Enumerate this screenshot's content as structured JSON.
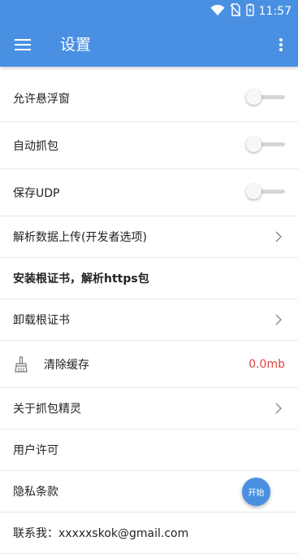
{
  "status": {
    "time": "11:57"
  },
  "appbar": {
    "title": "设置"
  },
  "settings": {
    "float_window": "允许悬浮窗",
    "auto_capture": "自动抓包",
    "save_udp": "保存UDP",
    "upload_data": "解析数据上传(开发者选项)",
    "install_cert": "安装根证书，解析https包",
    "uninstall_cert": "卸载根证书",
    "clear_cache": "清除缓存",
    "cache_size": "0.0mb",
    "about": "关于抓包精灵",
    "user_license": "用户许可",
    "privacy": "隐私条款",
    "contact": "联系我：xxxxxskok@gmail.com"
  },
  "fab": {
    "label": "开始"
  },
  "colors": {
    "primary": "#4a90e2",
    "accent_red": "#e0443e"
  }
}
